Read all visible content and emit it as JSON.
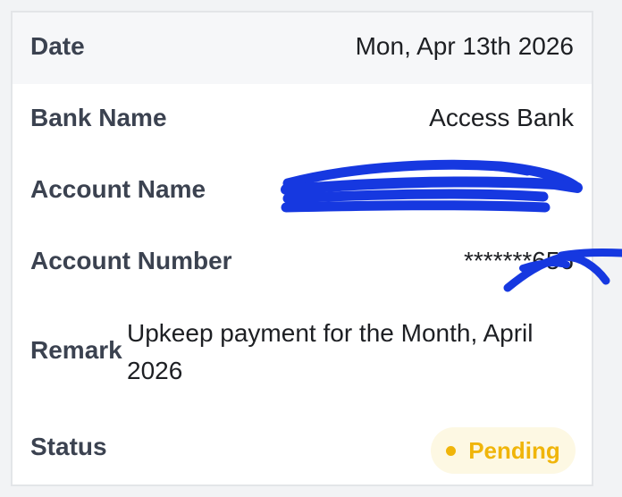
{
  "details": {
    "date": {
      "label": "Date",
      "value": "Mon, Apr 13th 2026"
    },
    "bank_name": {
      "label": "Bank Name",
      "value": "Access Bank"
    },
    "account_name": {
      "label": "Account Name",
      "value": ""
    },
    "account_number": {
      "label": "Account Number",
      "value": "*******656"
    },
    "remark": {
      "label": "Remark",
      "value": "Upkeep payment for the Month, April 2026"
    },
    "status": {
      "label": "Status",
      "value": "Pending",
      "color": "#f0b50a",
      "badge_bg": "#fdf8e3"
    }
  },
  "redaction": {
    "color": "#1638e0"
  }
}
